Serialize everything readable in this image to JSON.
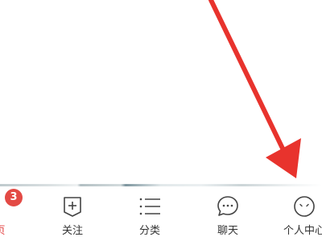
{
  "tabbar": {
    "tabs": [
      {
        "label": "页",
        "icon": "home-icon",
        "badge": "3",
        "active": true
      },
      {
        "label": "关注",
        "icon": "follow-icon",
        "active": false
      },
      {
        "label": "分类",
        "icon": "menu-list-icon",
        "active": false
      },
      {
        "label": "聊天",
        "icon": "chat-bubble-icon",
        "active": false
      },
      {
        "label": "个人中心",
        "icon": "profile-face-icon",
        "active": false
      }
    ]
  },
  "annotation": {
    "icon": "red-arrow-icon",
    "color": "#e8332d"
  },
  "colors": {
    "accent": "#e23c3c",
    "badge": "#e34a45",
    "text": "#333333",
    "icon_stroke": "#444444"
  }
}
